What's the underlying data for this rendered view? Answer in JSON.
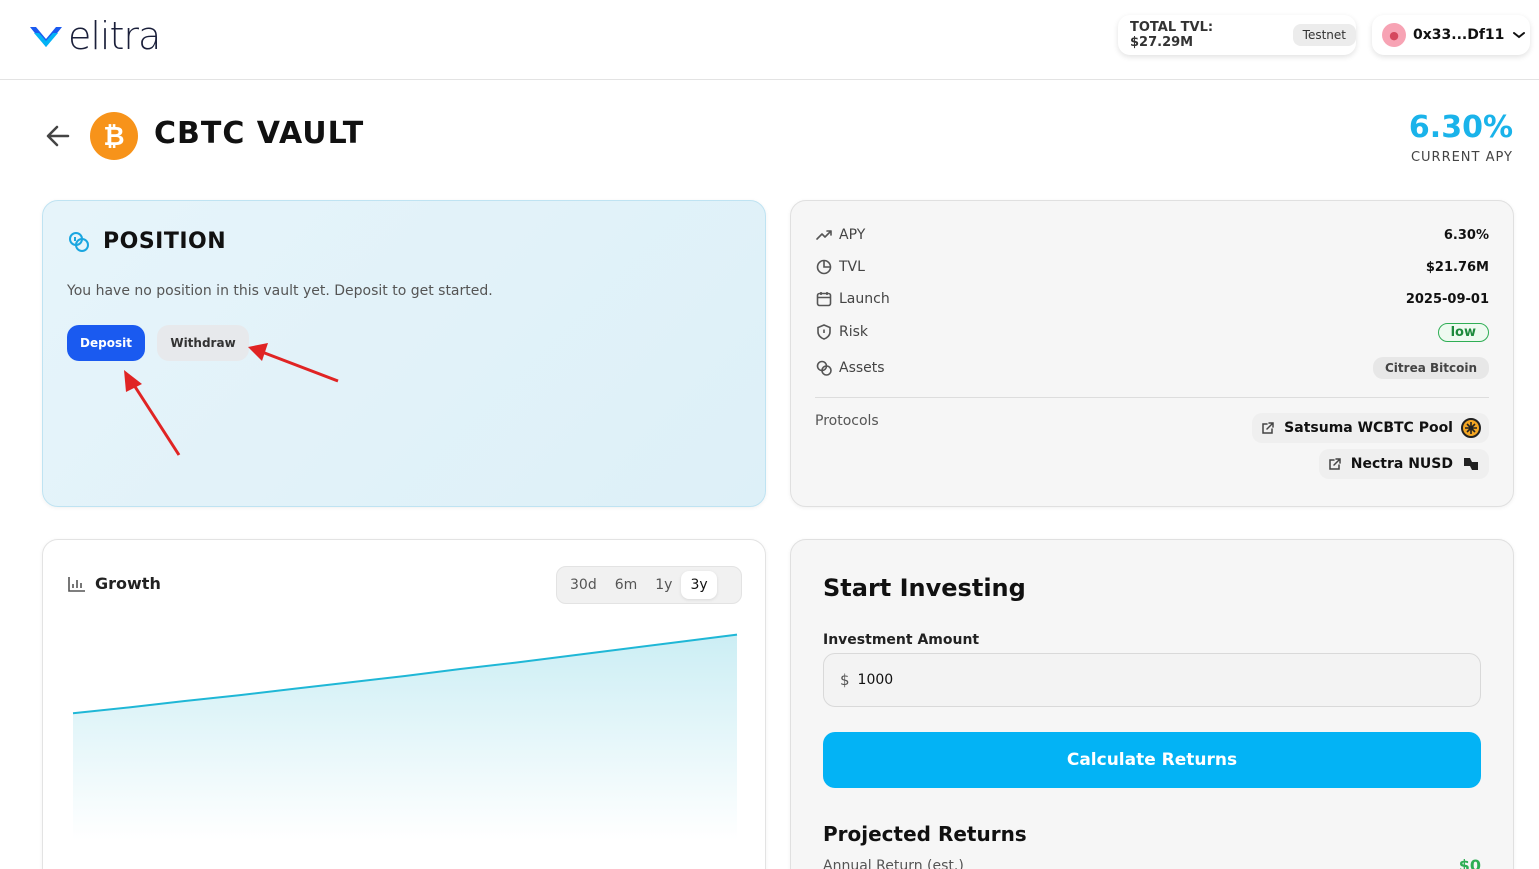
{
  "header": {
    "logo_text": "elitra",
    "total_tvl": "TOTAL TVL: $27.29M",
    "network_badge": "Testnet",
    "wallet_address": "0x33...Df11"
  },
  "vault": {
    "title": "CBTC VAULT",
    "current_apy": "6.30%",
    "current_apy_label": "CURRENT APY"
  },
  "position": {
    "title": "POSITION",
    "message": "You have no position in this vault yet. Deposit to get started.",
    "deposit_label": "Deposit",
    "withdraw_label": "Withdraw"
  },
  "stats": {
    "rows": [
      {
        "label": "APY",
        "value": "6.30%",
        "icon": "trending-up-icon"
      },
      {
        "label": "TVL",
        "value": "$21.76M",
        "icon": "pie-chart-icon"
      },
      {
        "label": "Launch",
        "value": "2025-09-01",
        "icon": "calendar-icon"
      },
      {
        "label": "Risk",
        "value": "low",
        "icon": "shield-icon"
      },
      {
        "label": "Assets",
        "value": "Citrea Bitcoin",
        "icon": "coins-icon"
      }
    ],
    "protocols_label": "Protocols",
    "protocols": [
      {
        "name": "Satsuma WCBTC Pool"
      },
      {
        "name": "Nectra NUSD"
      }
    ]
  },
  "growth": {
    "title": "Growth",
    "ranges": [
      "30d",
      "6m",
      "1y",
      "3y"
    ],
    "active_range": "3y"
  },
  "chart_data": {
    "type": "area",
    "title": "Growth",
    "x": [
      0,
      1,
      2,
      3,
      4,
      5,
      6,
      7,
      8,
      9,
      10,
      11,
      12
    ],
    "series": [
      {
        "values": [
          1000,
          1010,
          1021,
          1031,
          1042,
          1053,
          1064,
          1076,
          1087,
          1099,
          1111,
          1123,
          1135
        ]
      }
    ],
    "ylim": [
      800,
      1160
    ],
    "grid": false,
    "colors": {
      "line": "#1fb7d6",
      "fill": "#c6ecf3"
    }
  },
  "invest": {
    "title": "Start Investing",
    "amount_label": "Investment Amount",
    "currency_symbol": "$",
    "amount_value": "1000",
    "calculate_label": "Calculate Returns",
    "projected_title": "Projected Returns",
    "annual_label": "Annual Return (est.)",
    "annual_value": "$0"
  },
  "colors": {
    "accent": "#03b3f5",
    "deposit": "#1a5af0",
    "apy": "#1ab3ea",
    "risk_low": "#2fae55",
    "annotation_arrow": "#e02424"
  }
}
